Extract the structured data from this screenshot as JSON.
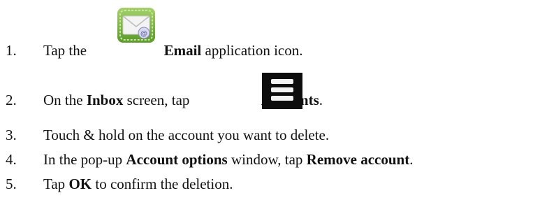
{
  "steps": [
    {
      "number": "1.",
      "before": "Tap the",
      "bold": "Email",
      "after": "application icon.",
      "icon": "email-app-icon"
    },
    {
      "number": "2.",
      "before": "On the",
      "bold1": "Inbox",
      "mid": "screen, tap",
      "icon": "menu-icon",
      "bold2": "Accounts",
      "after": "."
    },
    {
      "number": "3.",
      "text": "Touch & hold on the account you want to delete."
    },
    {
      "number": "4.",
      "before": "In the pop-up",
      "bold1": "Account options",
      "mid": "window, tap",
      "bold2": "Remove account",
      "after": "."
    },
    {
      "number": "5.",
      "before": "Tap",
      "bold": "OK",
      "after": "to confirm the deletion."
    }
  ],
  "colors": {
    "email_icon_green": "#7cb342",
    "email_icon_light": "#d9ecc2",
    "menu_icon_bg": "#111111"
  }
}
